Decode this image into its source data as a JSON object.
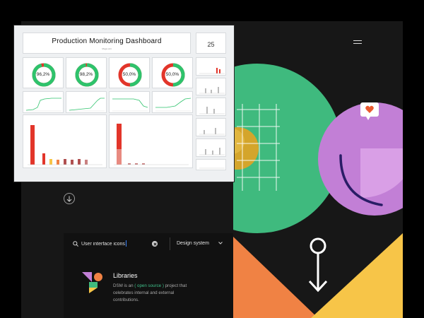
{
  "dashboard": {
    "title": "Production Monitoring Dashboard",
    "subtitle": "Mega unit",
    "kpi_value": "25",
    "gauges": [
      {
        "value": "96,2%",
        "fraction": 0.962
      },
      {
        "value": "98,2%",
        "fraction": 0.982
      },
      {
        "value": "50,0%",
        "fraction": 0.5
      },
      {
        "value": "50,0%",
        "fraction": 0.5
      }
    ]
  },
  "search": {
    "value": "User interface icons",
    "dropdown_value": "Design system"
  },
  "library": {
    "title": "Libraries",
    "desc_before": "DSM is an ",
    "link_text": "( open source )",
    "desc_after": " project that celebrates internal and external contributions."
  },
  "colors": {
    "gauge_good": "#2ec36c",
    "gauge_bad": "#e2352a",
    "green": "#3fba7e",
    "purple": "#c27fd6",
    "orange": "#f08244",
    "yellow": "#f7c548",
    "accent_link": "#3fc08a"
  }
}
